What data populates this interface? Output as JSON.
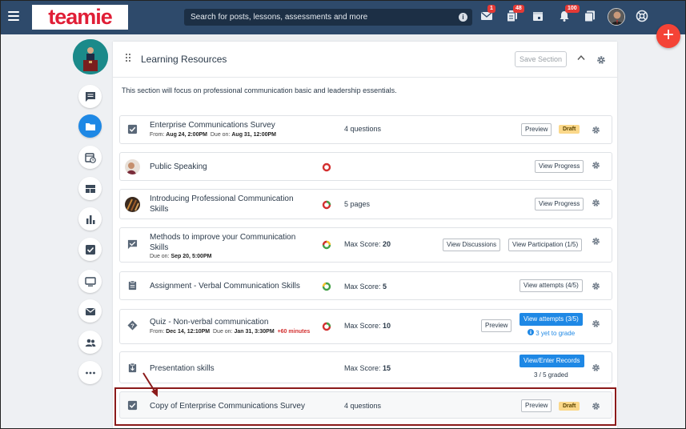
{
  "app": {
    "logo_text": "teamie",
    "brand_color": "#e01e36",
    "topbar_color": "#2e4a6b",
    "accent": "#1e88e5"
  },
  "search": {
    "placeholder": "Search for posts, lessons, assessments and more",
    "info_icon": "i"
  },
  "topbar_badges": {
    "messages": "1",
    "posts": "48",
    "notifications": "100"
  },
  "fab_label": "+",
  "section": {
    "title": "Learning Resources",
    "save_label": "Save Section",
    "description": "This section will focus on professional communication basic and leadership essentials."
  },
  "rows": [
    {
      "title": "Enterprise Communications Survey",
      "from_label": "From:",
      "from": "Aug 24, 2:00PM",
      "due_label": "Due on:",
      "due": "Aug 31, 12:00PM",
      "info": "4 questions",
      "preview": "Preview",
      "status": "Draft"
    },
    {
      "title": "Public Speaking",
      "action": "View Progress"
    },
    {
      "title_line1": "Introducing Professional Communication",
      "title_line2": "Skills",
      "info": "5 pages",
      "action": "View Progress"
    },
    {
      "title_line1": "Methods to improve your Communication",
      "title_line2": "Skills",
      "due_label": "Due on:",
      "due": "Sep 20, 5:00PM",
      "info_label": "Max Score:",
      "info_value": "20",
      "action1": "View Discussions",
      "action2": "View Participation (1/5)"
    },
    {
      "title": "Assignment - Verbal Communication Skills",
      "info_label": "Max Score:",
      "info_value": "5",
      "action": "View attempts (4/5)"
    },
    {
      "title": "Quiz - Non-verbal communication",
      "from_label": "From:",
      "from": "Dec 14, 12:10PM",
      "due_label": "Due on:",
      "due": "Jan 31, 3:30PM",
      "extra": "+60 minutes",
      "info_label": "Max Score:",
      "info_value": "10",
      "preview": "Preview",
      "action": "View attempts (3/5)",
      "note": "3 yet to grade"
    },
    {
      "title": "Presentation skills",
      "info_label": "Max Score:",
      "info_value": "15",
      "action": "View/Enter Records",
      "note": "3 / 5 graded"
    },
    {
      "title": "Copy of Enterprise Communications Survey",
      "info": "4 questions",
      "preview": "Preview",
      "status": "Draft"
    }
  ]
}
